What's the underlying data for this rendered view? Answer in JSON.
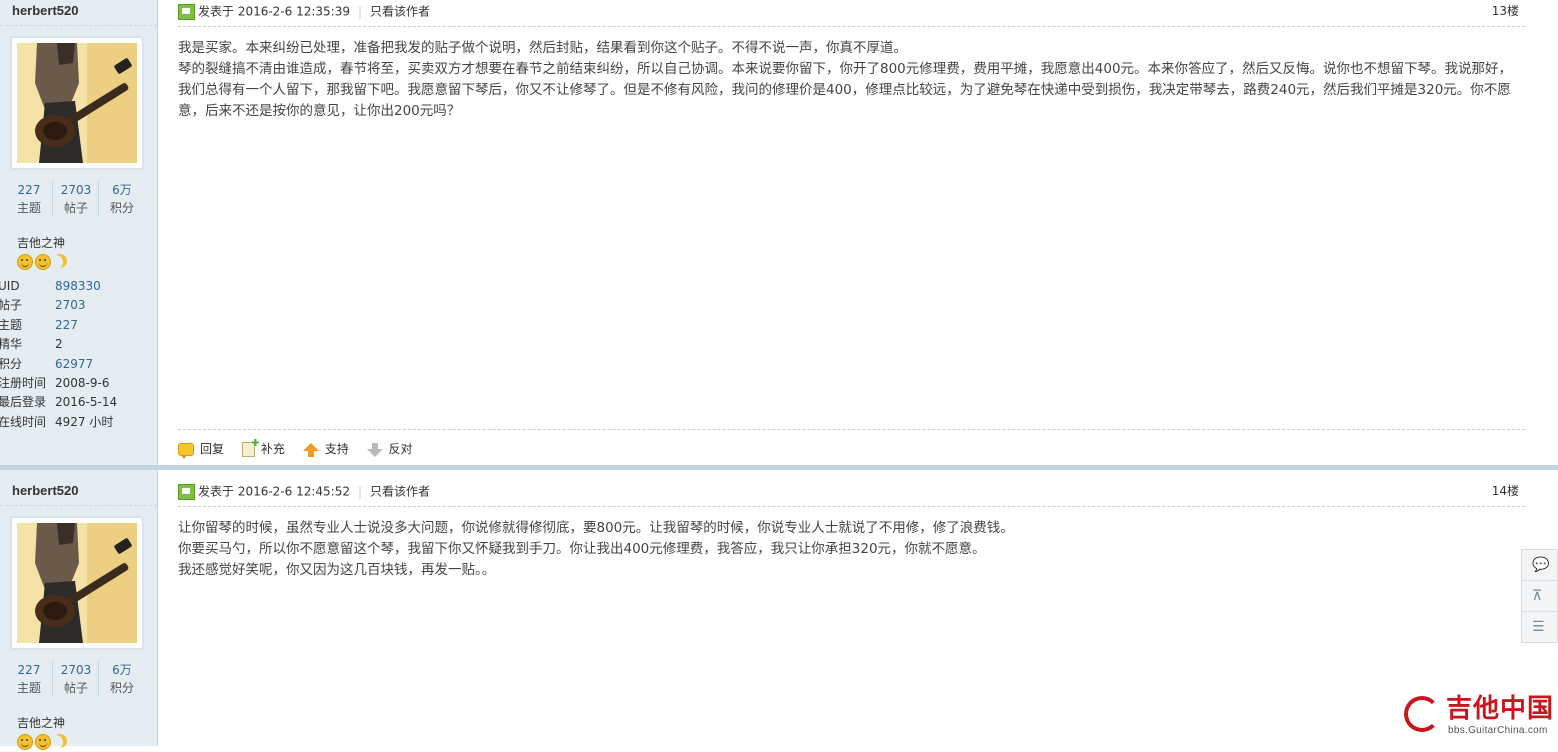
{
  "posts": [
    {
      "username": "herbert520",
      "stats": [
        {
          "num": "227",
          "label": "主题"
        },
        {
          "num": "2703",
          "label": "帖子"
        },
        {
          "num": "6万",
          "label": "积分"
        }
      ],
      "usergroup": "吉他之神",
      "info": [
        {
          "k": "UID",
          "v": "898330"
        },
        {
          "k": "帖子",
          "v": "2703"
        },
        {
          "k": "主题",
          "v": "227"
        },
        {
          "k": "精华",
          "v": "2"
        },
        {
          "k": "积分",
          "v": "62977"
        },
        {
          "k": "注册时间",
          "v": "2008-9-6"
        },
        {
          "k": "最后登录",
          "v": "2016-5-14"
        },
        {
          "k": "在线时间",
          "v": "4927 小时"
        }
      ],
      "posted": "发表于 2016-2-6 12:35:39",
      "author_only": "只看该作者",
      "floor": "13楼",
      "body": [
        "我是买家。本来纠纷已处理，准备把我发的贴子做个说明，然后封贴，结果看到你这个贴子。不得不说一声，你真不厚道。",
        "琴的裂缝搞不清由谁造成，春节将至，买卖双方才想要在春节之前结束纠纷，所以自己协调。本来说要你留下，你开了800元修理费，费用平摊，我愿意出400元。本来你答应了，然后又反悔。说你也不想留下琴。我说那好，我们总得有一个人留下，那我留下吧。我愿意留下琴后，你又不让修琴了。但是不修有风险，我问的修理价是400，修理点比较远，为了避免琴在快递中受到损伤，我决定带琴去，路费240元，然后我们平摊是320元。你不愿意，后来不还是按你的意见，让你出200元吗？"
      ],
      "actions": {
        "reply": "回复",
        "supplement": "补充",
        "support": "支持",
        "oppose": "反对"
      }
    },
    {
      "username": "herbert520",
      "stats": [
        {
          "num": "227",
          "label": "主题"
        },
        {
          "num": "2703",
          "label": "帖子"
        },
        {
          "num": "6万",
          "label": "积分"
        }
      ],
      "usergroup": "吉他之神",
      "posted": "发表于 2016-2-6 12:45:52",
      "author_only": "只看该作者",
      "floor": "14楼",
      "body": [
        "让你留琴的时候，虽然专业人士说没多大问题，你说修就得修彻底，要800元。让我留琴的时候，你说专业人士就说了不用修，修了浪费钱。",
        "你要买马勺，所以你不愿意留这个琴，我留下你又怀疑我到手刀。你让我出400元修理费，我答应，我只让你承担320元，你就不愿意。",
        "我还感觉好笑呢，你又因为这几百块钱，再发一贴。。"
      ]
    }
  ],
  "side_tools": [
    "comment-icon",
    "back-to-top-icon",
    "list-icon"
  ],
  "logo": {
    "name": "吉他中国",
    "domain": "bbs.GuitarChina.com"
  },
  "colors": {
    "sidebar_bg": "#e5edf2",
    "sidebar_border": "#c2d5e3",
    "link": "#336699",
    "logo_red": "#c8161e"
  }
}
